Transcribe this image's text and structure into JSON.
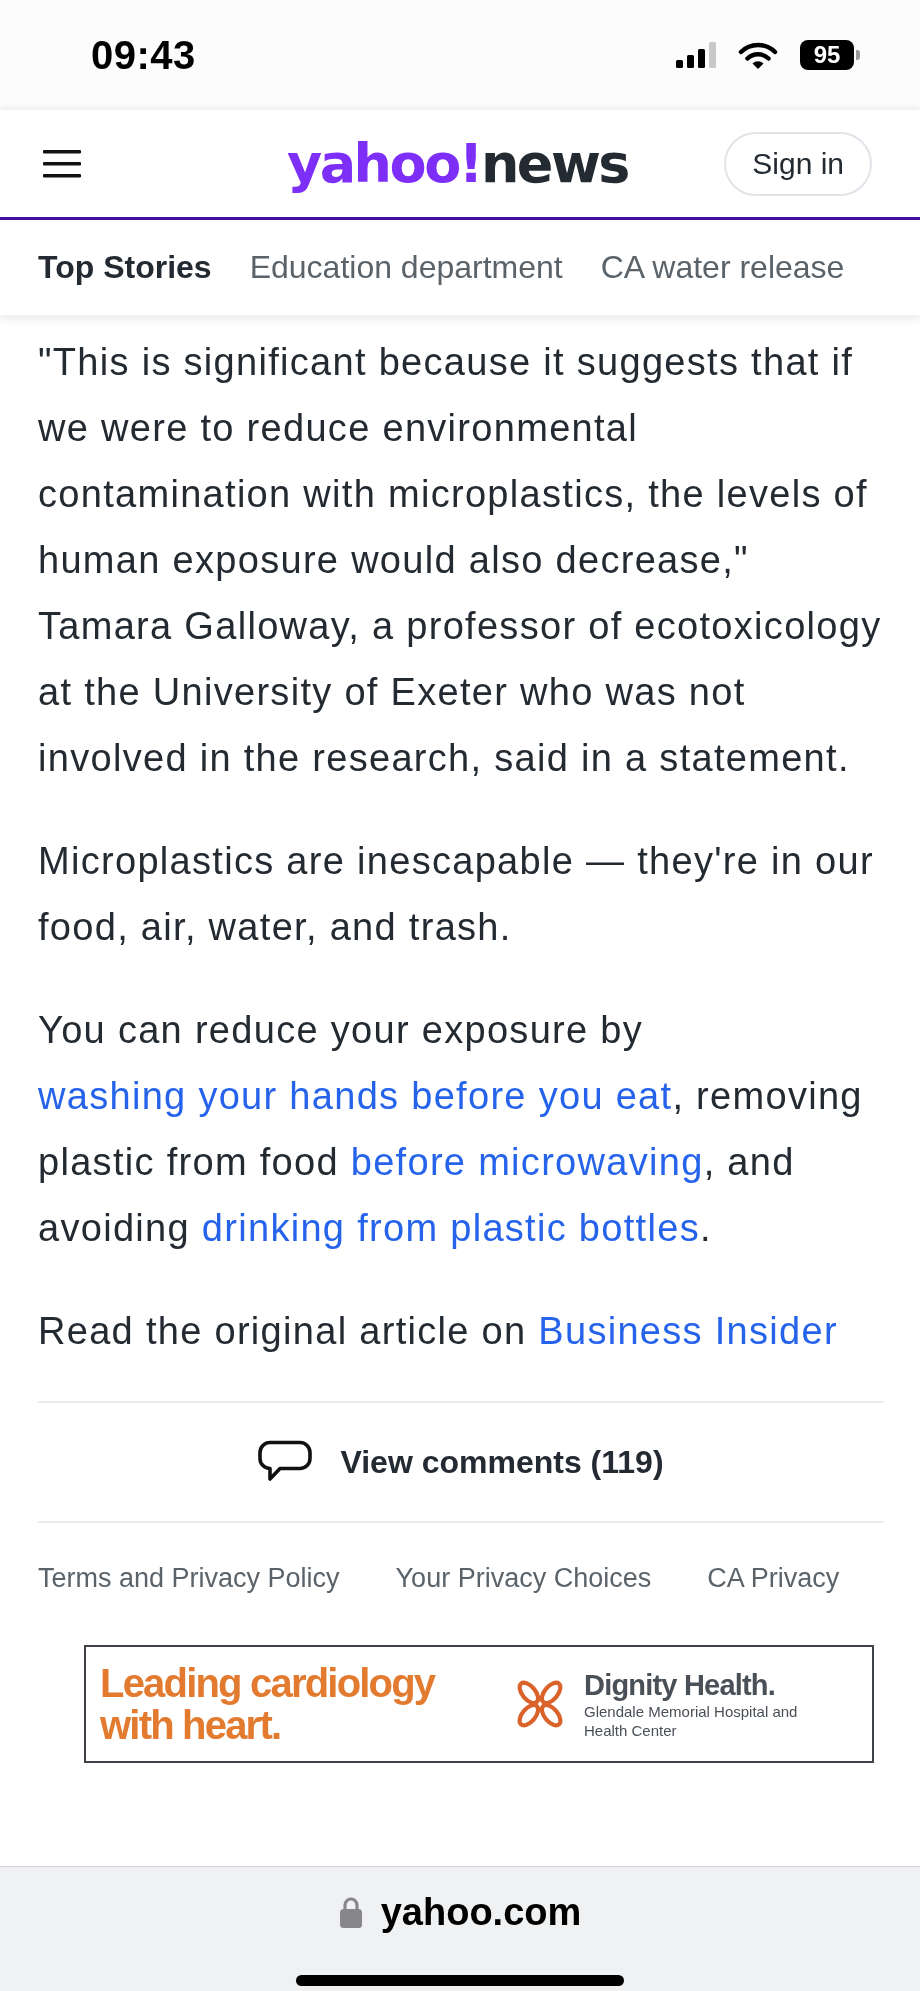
{
  "status_bar": {
    "time": "09:43",
    "battery": "95"
  },
  "header": {
    "logo": {
      "brand": "yahoo!",
      "product": "news"
    },
    "sign_in": "Sign in"
  },
  "tabs": [
    {
      "label": "Top Stories",
      "selected": true
    },
    {
      "label": "Education department",
      "selected": false
    },
    {
      "label": "CA water release",
      "selected": false
    }
  ],
  "article": {
    "paragraphs": [
      {
        "parts": [
          {
            "kind": "text",
            "text": "\"This is significant because it suggests that if we were to reduce environmental contamination with microplastics, the levels of human exposure would also decrease,\" Tamara Galloway, a professor of ecotoxicology at the University of Exeter who was not involved in the research, said in a statement."
          }
        ]
      },
      {
        "parts": [
          {
            "kind": "text",
            "text": "Microplastics are inescapable — they're in our food, air, water, and trash."
          }
        ]
      },
      {
        "parts": [
          {
            "kind": "text",
            "text": "You can reduce your exposure by "
          },
          {
            "kind": "link",
            "text": "washing your hands before you eat"
          },
          {
            "kind": "text",
            "text": ", removing plastic from food "
          },
          {
            "kind": "link",
            "text": "before microwaving"
          },
          {
            "kind": "text",
            "text": ", and avoiding "
          },
          {
            "kind": "link",
            "text": "drinking from plastic bottles"
          },
          {
            "kind": "text",
            "text": "."
          }
        ]
      },
      {
        "parts": [
          {
            "kind": "text",
            "text": "Read the original article on "
          },
          {
            "kind": "link",
            "text": "Business Insider"
          }
        ]
      }
    ]
  },
  "comments": {
    "label": "View comments (119)"
  },
  "footer_links": [
    "Terms and Privacy Policy",
    "Your Privacy Choices",
    "CA Privacy"
  ],
  "ad": {
    "headline": "Leading cardiology with heart.",
    "brand": "Dignity Health.",
    "subtitle": "Glendale Memorial Hospital and Health Center"
  },
  "browser_bar": {
    "url": "yahoo.com"
  }
}
